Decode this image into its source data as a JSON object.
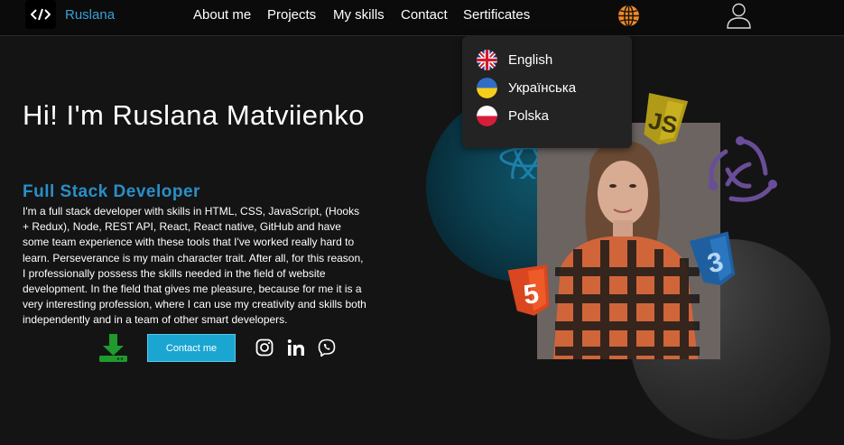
{
  "header": {
    "logo_icon": "code-brackets-icon",
    "name": "Ruslana",
    "nav": [
      "About me",
      "Projects",
      "My skills",
      "Contact",
      "Sertificates"
    ],
    "globe_icon": "globe-icon",
    "user_icon": "user-icon"
  },
  "languages": [
    {
      "label": "English",
      "flag": "uk-flag-icon"
    },
    {
      "label": "Українська",
      "flag": "ukraine-flag-icon"
    },
    {
      "label": "Polska",
      "flag": "poland-flag-icon"
    }
  ],
  "hero": {
    "title": "Hi! I'm Ruslana Matviienko",
    "role": "Full Stack Developer",
    "description": "I'm a full stack developer with skills in HTML, CSS, JavaScript, (Hooks + Redux), Node, REST API, React, React native, GitHub and have some team experience with these tools that I've worked really hard to learn. Perseverance is my main character trait. After all, for this reason, I professionally possess the skills needed in the field of website development. In the field that gives me pleasure, because for me it is a very interesting profession, where I can use my creativity and skills both independently and in a team of other smart developers.",
    "contact_label": "Contact me",
    "download_icon": "download-icon",
    "socials": [
      "instagram-icon",
      "linkedin-icon",
      "viber-icon"
    ]
  },
  "colors": {
    "accent_blue": "#2a8fc8",
    "button": "#1ba6d2",
    "globe": "#f5891f",
    "download": "#1f9a2e",
    "background": "#141414"
  }
}
